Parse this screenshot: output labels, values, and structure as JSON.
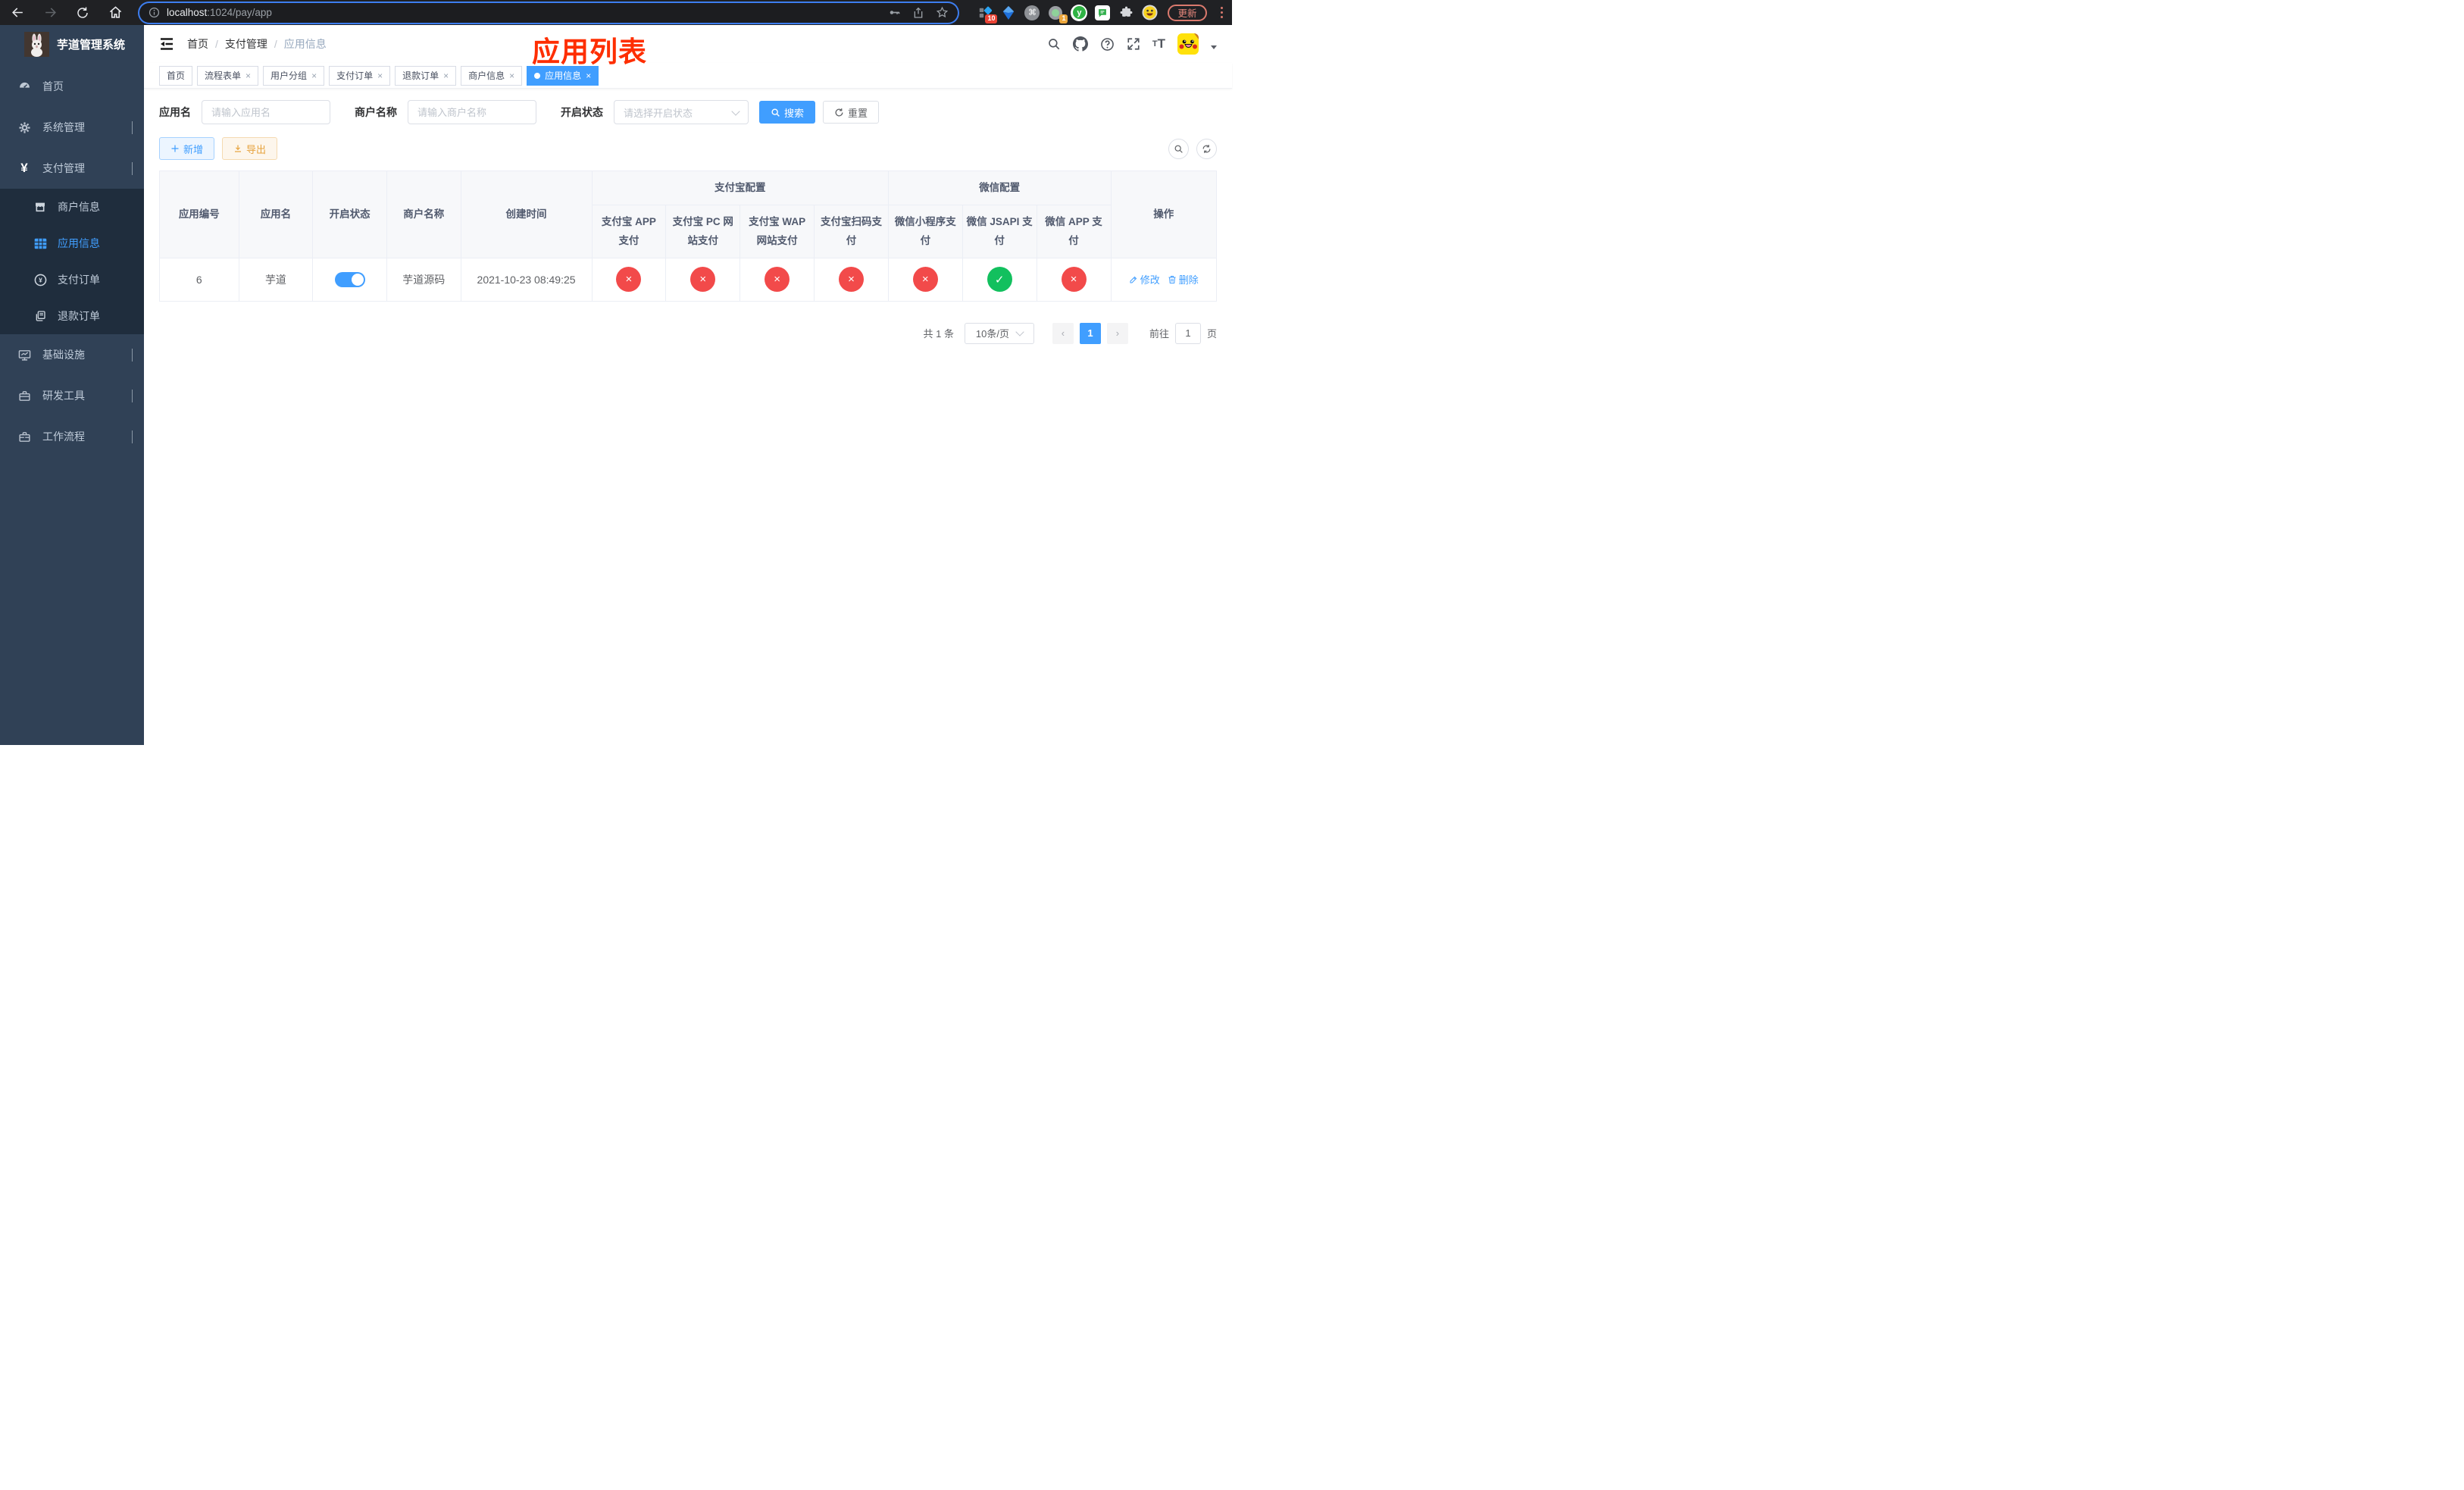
{
  "browser": {
    "url": {
      "host": "localhost",
      "rest": ":1024/pay/app"
    },
    "update_label": "更新",
    "ext_badge_first": "10",
    "ext_badge_second": "1",
    "ext_y_letter": "y"
  },
  "sidebar": {
    "title": "芋道管理系统",
    "menu": [
      {
        "label": "首页"
      },
      {
        "label": "系统管理"
      },
      {
        "label": "支付管理"
      },
      {
        "label": "商户信息"
      },
      {
        "label": "应用信息"
      },
      {
        "label": "支付订单"
      },
      {
        "label": "退款订单"
      },
      {
        "label": "基础设施"
      },
      {
        "label": "研发工具"
      },
      {
        "label": "工作流程"
      }
    ]
  },
  "header": {
    "breadcrumb": {
      "items": [
        "首页",
        "支付管理",
        "应用信息"
      ],
      "sep": "/"
    },
    "annotation": "应用列表"
  },
  "tabs": [
    {
      "label": "首页"
    },
    {
      "label": "流程表单"
    },
    {
      "label": "用户分组"
    },
    {
      "label": "支付订单"
    },
    {
      "label": "退款订单"
    },
    {
      "label": "商户信息"
    },
    {
      "label": "应用信息"
    }
  ],
  "filters": {
    "app_name": {
      "label": "应用名",
      "placeholder": "请输入应用名"
    },
    "merchant_name": {
      "label": "商户名称",
      "placeholder": "请输入商户名称"
    },
    "status": {
      "label": "开启状态",
      "placeholder": "请选择开启状态"
    },
    "search": "搜索",
    "reset": "重置"
  },
  "toolbar": {
    "add": "新增",
    "export": "导出"
  },
  "table": {
    "groups": {
      "alipay": "支付宝配置",
      "wechat": "微信配置"
    },
    "columns": {
      "id": "应用编号",
      "name": "应用名",
      "status": "开启状态",
      "merchant": "商户名称",
      "created": "创建时间",
      "actions": "操作"
    },
    "pay_columns": [
      "支付宝 APP 支付",
      "支付宝 PC 网站支付",
      "支付宝 WAP 网站支付",
      "支付宝扫码支付",
      "微信小程序支付",
      "微信 JSAPI 支付",
      "微信 APP 支付"
    ],
    "rows": [
      {
        "id": "6",
        "name": "芋道",
        "enabled": "enabled",
        "merchant": "芋道源码",
        "created": "2021-10-23 08:49:25",
        "configs": [
          "disabled",
          "disabled",
          "disabled",
          "disabled",
          "disabled",
          "enabled",
          "disabled"
        ],
        "edit": "修改",
        "delete": "删除"
      }
    ]
  },
  "pagination": {
    "total": "共 1 条",
    "page_size": "10条/页",
    "current_page": "1",
    "goto_label": "前往",
    "goto_value": "1",
    "page_unit": "页"
  }
}
